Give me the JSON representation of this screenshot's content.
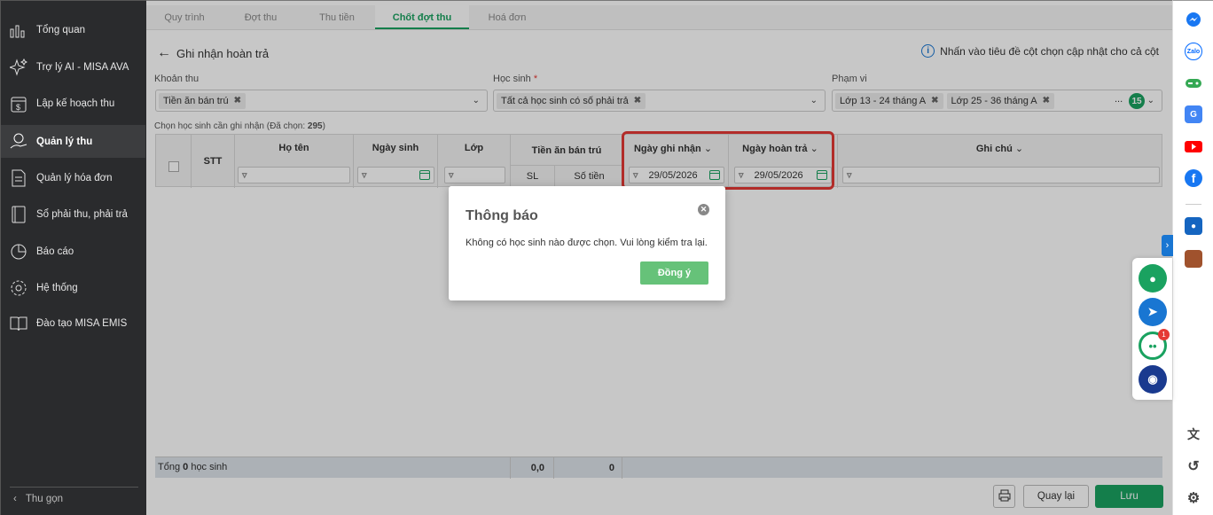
{
  "sidebar": {
    "items": [
      {
        "label": "Tổng quan",
        "icon": "chart-bars-icon"
      },
      {
        "label": "Trợ lý AI - MISA AVA",
        "icon": "sparkle-icon"
      },
      {
        "label": "Lập kế hoạch thu",
        "icon": "calendar-dollar-icon"
      },
      {
        "label": "Quản lý thu",
        "icon": "money-hand-icon"
      },
      {
        "label": "Quản lý hóa đơn",
        "icon": "invoice-icon"
      },
      {
        "label": "Sổ phải thu, phải trả",
        "icon": "ledger-icon"
      },
      {
        "label": "Báo cáo",
        "icon": "pie-chart-icon"
      },
      {
        "label": "Hệ thống",
        "icon": "gear-icon"
      },
      {
        "label": "Đào tạo MISA EMIS",
        "icon": "book-icon"
      }
    ],
    "collapse_label": "Thu gọn"
  },
  "tabs": [
    "Quy trình",
    "Đợt thu",
    "Thu tiền",
    "Chốt đợt thu",
    "Hoá đơn"
  ],
  "active_tab": "Chốt đợt thu",
  "page": {
    "title": "Ghi nhận hoàn trả",
    "hint": "Nhấn vào tiêu đề cột chọn cập nhật cho cả cột"
  },
  "filters": {
    "khoan_thu": {
      "label": "Khoản thu",
      "chips": [
        "Tiền ăn bán trú"
      ]
    },
    "hoc_sinh": {
      "label": "Học sinh",
      "required": "*",
      "chips": [
        "Tất cả học sinh có số phải trả"
      ]
    },
    "pham_vi": {
      "label": "Phạm vi",
      "chips": [
        "Lớp 13 - 24 tháng A",
        "Lớp 25 - 36 tháng A"
      ],
      "more": "...",
      "count": "15"
    }
  },
  "grid": {
    "caption_prefix": "Chọn học sinh cần ghi nhận (Đã chọn: ",
    "caption_count": "295",
    "caption_suffix": ")",
    "columns": {
      "stt": "STT",
      "ho_ten": "Họ tên",
      "ngay_sinh": "Ngày sinh",
      "lop": "Lớp",
      "tien_an": "Tiền ăn bán trú",
      "sl": "SL",
      "so_tien": "Số tiền",
      "ngay_ghi_nhan": "Ngày ghi nhận",
      "ngay_hoan_tra": "Ngày hoàn trả",
      "ghi_chu": "Ghi chú"
    },
    "date_ghi_nhan": "29/05/2026",
    "date_hoan_tra": "29/05/2026"
  },
  "footer": {
    "total_prefix": "Tổng ",
    "total_count": "0",
    "total_suffix": " học sinh",
    "sl_total": "0,0",
    "amount_total": "0"
  },
  "buttons": {
    "back": "Quay lại",
    "save": "Lưu"
  },
  "dialog": {
    "title": "Thông báo",
    "message": "Không có học sinh nào được chọn. Vui lòng kiểm tra lại.",
    "ok": "Đồng ý"
  },
  "right_bar": {
    "icons": [
      "messenger-icon",
      "zalo-icon",
      "game-icon",
      "translate-icon",
      "youtube-icon",
      "facebook-icon",
      "app-icon",
      "avatar-icon",
      "translate-page-icon",
      "history-icon",
      "settings-icon"
    ],
    "zalo_text": "Zalo",
    "notification_count": "1"
  },
  "colors": {
    "accent": "#1aa260",
    "highlight": "#e53935",
    "sidebar": "#2a2b2d"
  }
}
